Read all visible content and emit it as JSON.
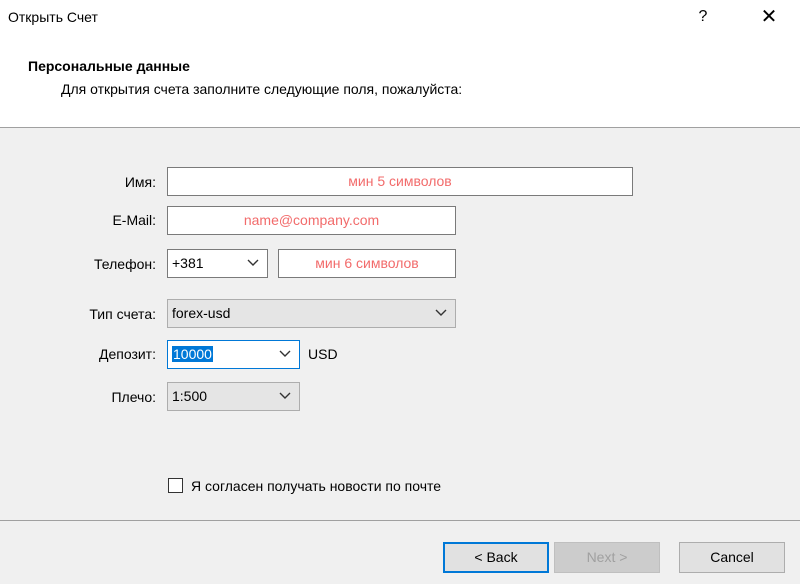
{
  "window": {
    "title": "Открыть Счет",
    "help_label": "?",
    "close_label": "✕"
  },
  "header": {
    "title": "Персональные данные",
    "subtitle": "Для открытия счета заполните следующие поля, пожалуйста:"
  },
  "form": {
    "name": {
      "label": "Имя:",
      "placeholder": "мин 5 символов"
    },
    "email": {
      "label": "E-Mail:",
      "placeholder": "name@company.com"
    },
    "phone": {
      "label": "Телефон:",
      "code": "+381",
      "placeholder": "мин 6 символов"
    },
    "account_type": {
      "label": "Тип счета:",
      "value": "forex-usd"
    },
    "deposit": {
      "label": "Депозит:",
      "value": "10000",
      "currency": "USD"
    },
    "leverage": {
      "label": "Плечо:",
      "value": "1:500"
    },
    "newsletter": {
      "label": "Я согласен получать новости по почте",
      "checked": false
    }
  },
  "footer": {
    "back_label": "< Back",
    "next_label": "Next >",
    "cancel_label": "Cancel"
  },
  "colors": {
    "placeholder": "#f26b6b",
    "accent": "#0078d7"
  }
}
